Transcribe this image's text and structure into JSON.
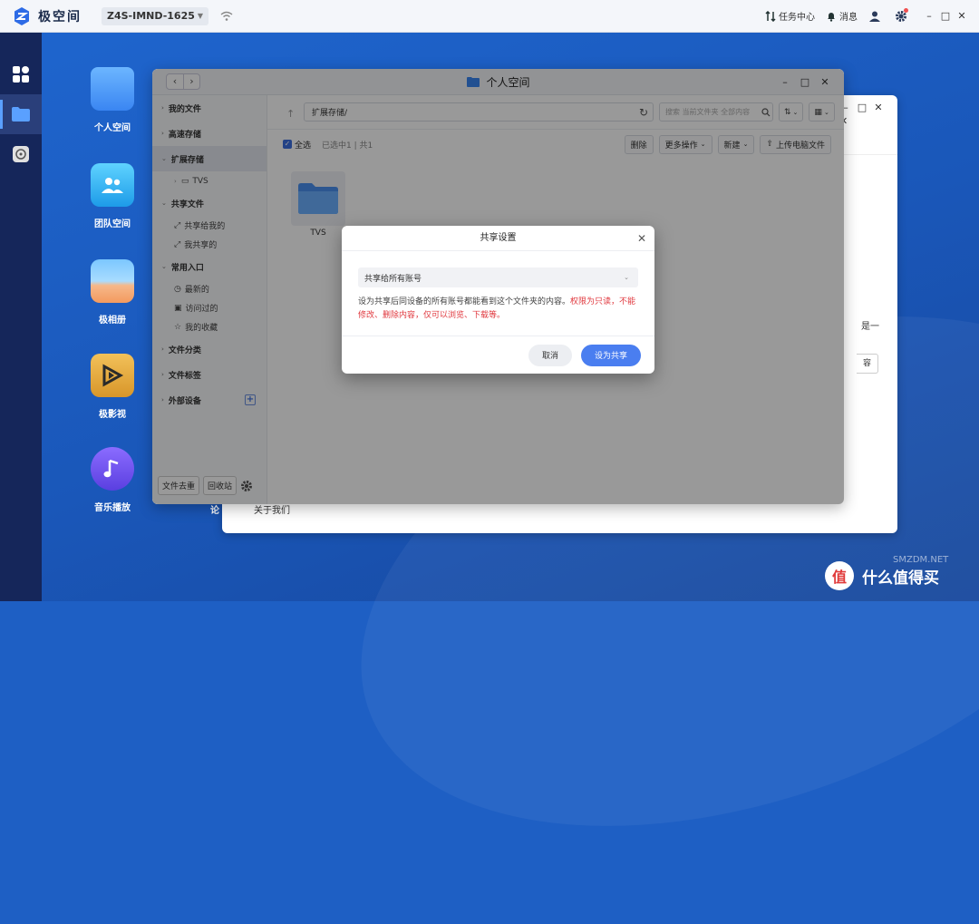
{
  "topbar": {
    "app_name": "极空间",
    "device_name": "Z4S-IMND-1625",
    "task_center": "任务中心",
    "messages": "消息"
  },
  "desktop": {
    "icons": [
      {
        "label": "个人空间"
      },
      {
        "label": "团队空间"
      },
      {
        "label": "极相册"
      },
      {
        "label": "极影视"
      },
      {
        "label": "音乐播放"
      }
    ],
    "partial_label": "论",
    "about_us": "关于我们"
  },
  "back_window": {
    "partial_text_1": "是一",
    "partial_text_2": "容"
  },
  "window": {
    "title": "个人空间",
    "sidebar": {
      "my_files": "我的文件",
      "fast_storage": "高速存储",
      "ext_storage": "扩展存储",
      "tvs": "TVS",
      "shared_files": "共享文件",
      "shared_with_me": "共享给我的",
      "my_shares": "我共享的",
      "common_entry": "常用入口",
      "recent": "最新的",
      "visited": "访问过的",
      "favorites": "我的收藏",
      "file_category": "文件分类",
      "file_tags": "文件标签",
      "external_devices": "外部设备",
      "file_depot": "文件去重",
      "recycle_bin": "回收站"
    },
    "path": "扩展存储/",
    "search_placeholder": "搜索 当前文件夹 全部内容",
    "select_all": "全选",
    "selection_info": "已选中1 | 共1",
    "actions": {
      "delete": "删除",
      "more": "更多操作",
      "new": "新建",
      "upload": "上传电脑文件"
    },
    "folder_name": "TVS"
  },
  "dialog": {
    "title": "共享设置",
    "select_value": "共享给所有账号",
    "note_normal": "设为共享后同设备的所有账号都能看到这个文件夹的内容。",
    "note_red": "权限为只读，不能修改、删除内容，仅可以浏览、下载等。",
    "cancel": "取消",
    "confirm": "设为共享"
  },
  "watermark": {
    "text": "什么值得买",
    "sub": "SMZDM.NET"
  },
  "colors": {
    "accent": "#4a7ef0",
    "warning_red": "#e0383e",
    "dock": "#15265a",
    "desktop": "#1e5fc4"
  }
}
